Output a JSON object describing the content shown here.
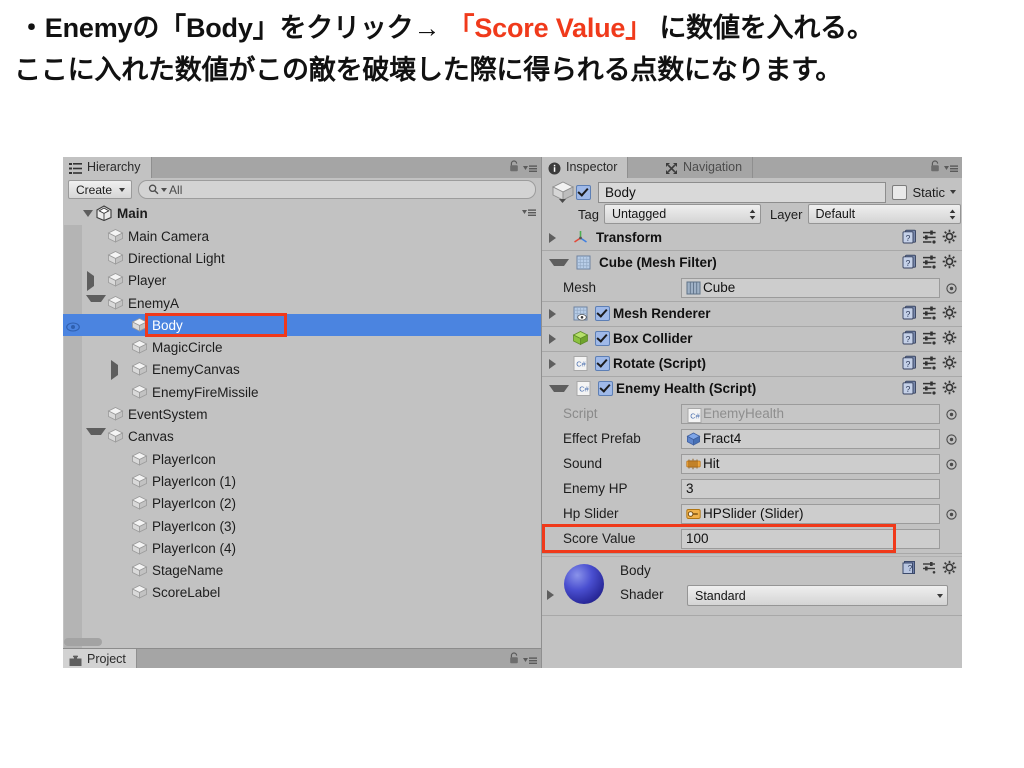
{
  "caption": {
    "line1_pre": "・Enemyの「Body」をクリック→ ",
    "line1_red": "「Score Value」",
    "line1_post": " に数値を入れる。",
    "line2": "ここに入れた数値がこの敵を破壊した際に得られる点数になります。",
    "highlight_color": "#f03a1b"
  },
  "hierarchy": {
    "tab_label": "Hierarchy",
    "tab_icon": "hierarchy-list-icon",
    "create_label": "Create",
    "search_placeholder": "All",
    "search_value": "All",
    "search_icon": "search-icon",
    "scene_name": "Main",
    "tree": [
      {
        "label": "Main Camera",
        "depth": 1,
        "twisty": "none",
        "selected": false
      },
      {
        "label": "Directional Light",
        "depth": 1,
        "twisty": "none",
        "selected": false
      },
      {
        "label": "Player",
        "depth": 1,
        "twisty": "collapsed",
        "selected": false
      },
      {
        "label": "EnemyA",
        "depth": 1,
        "twisty": "expanded",
        "selected": false
      },
      {
        "label": "Body",
        "depth": 2,
        "twisty": "none",
        "selected": true
      },
      {
        "label": "MagicCircle",
        "depth": 2,
        "twisty": "none",
        "selected": false
      },
      {
        "label": "EnemyCanvas",
        "depth": 2,
        "twisty": "collapsed",
        "selected": false
      },
      {
        "label": "EnemyFireMissile",
        "depth": 2,
        "twisty": "none",
        "selected": false
      },
      {
        "label": "EventSystem",
        "depth": 1,
        "twisty": "none",
        "selected": false
      },
      {
        "label": "Canvas",
        "depth": 1,
        "twisty": "expanded",
        "selected": false
      },
      {
        "label": "PlayerIcon",
        "depth": 2,
        "twisty": "none",
        "selected": false
      },
      {
        "label": "PlayerIcon (1)",
        "depth": 2,
        "twisty": "none",
        "selected": false
      },
      {
        "label": "PlayerIcon (2)",
        "depth": 2,
        "twisty": "none",
        "selected": false
      },
      {
        "label": "PlayerIcon (3)",
        "depth": 2,
        "twisty": "none",
        "selected": false
      },
      {
        "label": "PlayerIcon (4)",
        "depth": 2,
        "twisty": "none",
        "selected": false
      },
      {
        "label": "StageName",
        "depth": 2,
        "twisty": "none",
        "selected": false
      },
      {
        "label": "ScoreLabel",
        "depth": 2,
        "twisty": "none",
        "selected": false
      }
    ],
    "selection_color": "#4b84e0"
  },
  "project": {
    "tab_label": "Project",
    "tab_icon": "folder-icon"
  },
  "inspector": {
    "tabs": [
      {
        "label": "Inspector",
        "icon": "info-icon",
        "active": true
      },
      {
        "label": "Navigation",
        "icon": "navigation-icon",
        "active": false
      }
    ],
    "object": {
      "enabled": true,
      "name": "Body",
      "static_label": "Static",
      "static_checked": false,
      "tag_label": "Tag",
      "tag_value": "Untagged",
      "layer_label": "Layer",
      "layer_value": "Default"
    },
    "components": [
      {
        "title": "Transform",
        "icon": "transform-icon",
        "expanded": false,
        "has_checkbox": false,
        "checked": false
      },
      {
        "title": "Cube (Mesh Filter)",
        "icon": "mesh-filter-icon",
        "expanded": true,
        "has_checkbox": false,
        "checked": false
      },
      {
        "title": "Mesh Renderer",
        "icon": "mesh-renderer-icon",
        "expanded": false,
        "has_checkbox": true,
        "checked": true
      },
      {
        "title": "Box Collider",
        "icon": "box-collider-icon",
        "expanded": false,
        "has_checkbox": true,
        "checked": true
      },
      {
        "title": "Rotate (Script)",
        "icon": "csharp-icon",
        "expanded": false,
        "has_checkbox": true,
        "checked": true
      },
      {
        "title": "Enemy Health (Script)",
        "icon": "csharp-icon",
        "expanded": true,
        "has_checkbox": true,
        "checked": true
      }
    ],
    "mesh_filter_row": {
      "name": "Mesh",
      "value": "Cube",
      "icon": "mesh-icon"
    },
    "enemy_health_rows": [
      {
        "name": "Script",
        "value": "EnemyHealth",
        "icon": "csharp-icon",
        "dim": true,
        "objectpicker": true
      },
      {
        "name": "Effect Prefab",
        "value": "Fract4",
        "icon": "prefab-icon",
        "dim": false,
        "objectpicker": true
      },
      {
        "name": "Sound",
        "value": "Hit",
        "icon": "audioclip-icon",
        "dim": false,
        "objectpicker": true
      },
      {
        "name": "Enemy HP",
        "value": "3",
        "icon": "none",
        "dim": false,
        "objectpicker": false
      },
      {
        "name": "Hp Slider",
        "value": "HPSlider (Slider)",
        "icon": "slider-icon",
        "dim": false,
        "objectpicker": true
      },
      {
        "name": "Score Value",
        "value": "100",
        "icon": "none",
        "dim": false,
        "objectpicker": false
      }
    ],
    "material": {
      "name": "Body",
      "shader_label": "Shader",
      "shader_value": "Standard"
    },
    "row_icons": {
      "help": "help-icon",
      "preset": "preset-icon",
      "settings": "gear-icon"
    }
  },
  "annotations": {
    "box_color": "#f0391a",
    "boxes": [
      {
        "target": "hierarchy-body-item"
      },
      {
        "target": "inspector-score-value-row"
      }
    ]
  }
}
